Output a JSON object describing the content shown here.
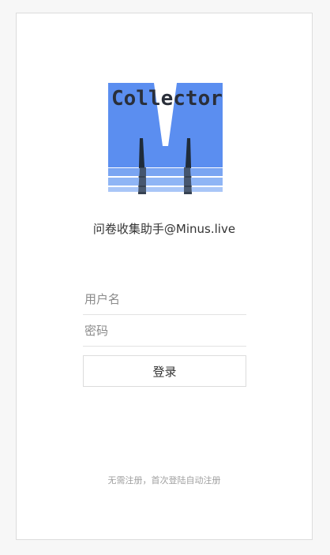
{
  "logo": {
    "text": "Collector",
    "letter": "M",
    "colors": {
      "blue": "#5b8ef0",
      "light_blue": "#8fb5f5",
      "dark": "#1f2b3a"
    }
  },
  "app_title": "问卷收集助手@Minus.live",
  "form": {
    "username_placeholder": "用户名",
    "password_placeholder": "密码",
    "login_label": "登录"
  },
  "hint": "无需注册，首次登陆自动注册"
}
